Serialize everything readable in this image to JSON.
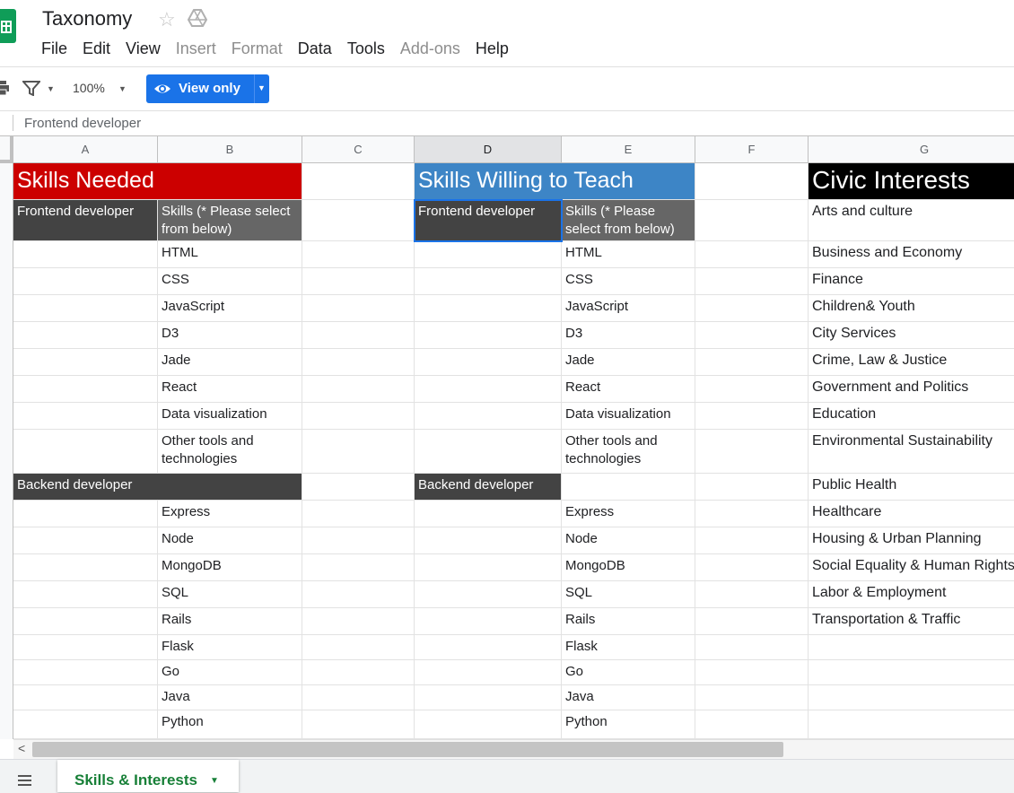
{
  "app": {
    "title": "Taxonomy",
    "menu": [
      {
        "label": "File",
        "enabled": true
      },
      {
        "label": "Edit",
        "enabled": true
      },
      {
        "label": "View",
        "enabled": true
      },
      {
        "label": "Insert",
        "enabled": false
      },
      {
        "label": "Format",
        "enabled": false
      },
      {
        "label": "Data",
        "enabled": true
      },
      {
        "label": "Tools",
        "enabled": true
      },
      {
        "label": "Add-ons",
        "enabled": false
      },
      {
        "label": "Help",
        "enabled": true
      }
    ]
  },
  "toolbar": {
    "zoom": "100%",
    "view_label": "View only"
  },
  "formula_bar": {
    "value": "Frontend developer"
  },
  "columns": [
    "A",
    "B",
    "C",
    "D",
    "E",
    "F",
    "G"
  ],
  "selected_column": "D",
  "colors": {
    "skills_needed_header": "#cc0000",
    "skills_teach_header": "#3d85c6",
    "civic_header": "#000000",
    "dark_cell": "#434343",
    "accent": "#1a73e8",
    "tab_green": "#188038"
  },
  "sheet": {
    "skills_needed_title": "Skills Needed",
    "skills_teach_title": "Skills Willing to Teach",
    "civic_title": "Civic Interests",
    "frontend_label": "Frontend developer",
    "skills_hint": "Skills (* Please select from below)",
    "backend_label": "Backend developer",
    "frontend_skills": [
      "HTML",
      "CSS",
      "JavaScript",
      "D3",
      "Jade",
      "React",
      "Data visualization",
      "Other tools and technologies"
    ],
    "backend_skills": [
      "Express",
      "Node",
      "MongoDB",
      "SQL",
      "Rails",
      "Flask",
      "Go",
      "Java",
      "Python"
    ],
    "civic_interests": [
      "Arts and culture",
      "Business and Economy",
      "Finance",
      "Children& Youth",
      "City Services",
      "Crime, Law & Justice",
      "Government and Politics",
      "Education",
      "Environmental Sustainability",
      "Public Health",
      "Healthcare",
      "Housing & Urban Planning",
      "Social Equality & Human Rights",
      "Labor & Employment",
      "Transportation & Traffic"
    ]
  },
  "tabs": {
    "active": "Skills & Interests"
  }
}
